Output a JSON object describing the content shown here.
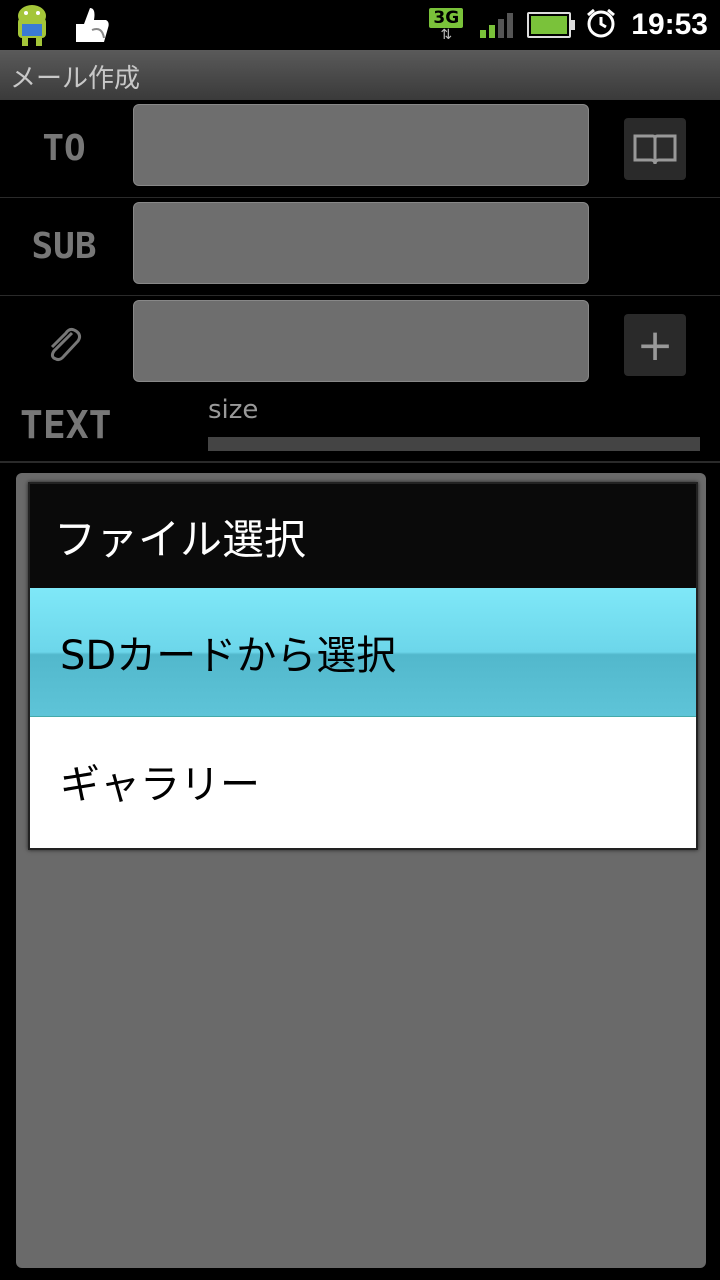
{
  "status_bar": {
    "network_label": "3G",
    "network_arrows": "⇅",
    "time": "19:53",
    "icons": [
      "android-app-icon",
      "thumbs-up-icon",
      "signal-icon",
      "battery-icon",
      "alarm-clock-icon"
    ]
  },
  "title_bar": {
    "title": "メール作成"
  },
  "form": {
    "to_label": "TO",
    "sub_label": "SUB",
    "text_label": "TEXT",
    "size_label": "size"
  },
  "dialog": {
    "title": "ファイル選択",
    "options": [
      {
        "label": "SDカードから選択",
        "selected": true
      },
      {
        "label": "ギャラリー",
        "selected": false
      }
    ]
  },
  "colors": {
    "selected_option": "#6cd6ea",
    "network_badge": "#7ac23a",
    "field_bg": "#6e6e6e"
  }
}
